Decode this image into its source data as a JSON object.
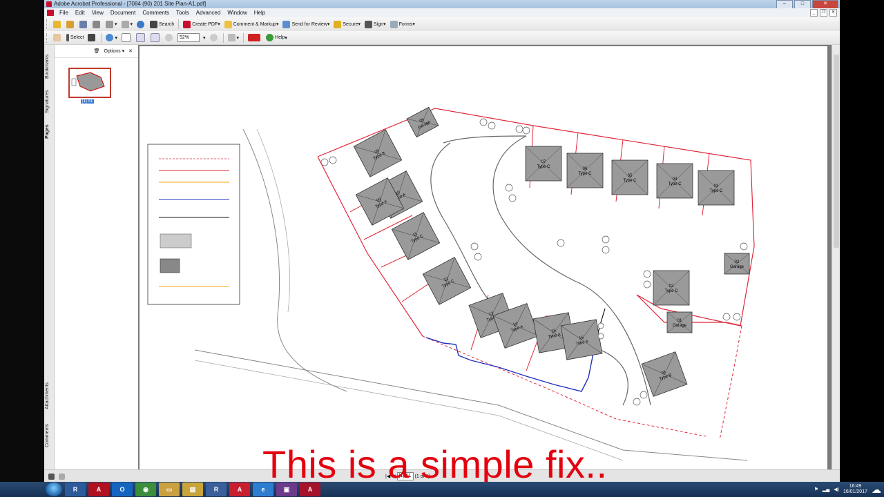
{
  "window": {
    "title": "Adobe Acrobat Professional - [7084 (90) 201  Site Plan-A1.pdf]"
  },
  "menu": [
    "File",
    "Edit",
    "View",
    "Document",
    "Comments",
    "Tools",
    "Advanced",
    "Window",
    "Help"
  ],
  "toolbar1": {
    "search": "Search",
    "create_pdf": "Create PDF",
    "comment_markup": "Comment & Markup",
    "send_review": "Send for Review",
    "secure": "Secure",
    "sign": "Sign",
    "forms": "Forms"
  },
  "toolbar2": {
    "select": "Select",
    "zoom": "52%",
    "help": "Help"
  },
  "nav_tabs": {
    "bookmarks": "Bookmarks",
    "signatures": "Signatures",
    "pages": "Pages",
    "attachments": "Attachments",
    "comments": "Comments"
  },
  "pages_pane": {
    "options": "Options",
    "thumb_label": "[1] A1"
  },
  "statusbar": {
    "page_box": "[1] A1",
    "page_of": "(1 of 1)"
  },
  "plan": {
    "houses": [
      {
        "num": "09",
        "type": "Type B"
      },
      {
        "num": "09",
        "type": "Garage"
      },
      {
        "num": "10",
        "type": "Type A"
      },
      {
        "num": "09",
        "type": "Type A"
      },
      {
        "num": "11",
        "type": "Type C"
      },
      {
        "num": "12",
        "type": "Type C"
      },
      {
        "num": "13",
        "type": "Type A"
      },
      {
        "num": "14",
        "type": "Type A"
      },
      {
        "num": "15",
        "type": "Type A"
      },
      {
        "num": "16",
        "type": "Type A"
      },
      {
        "num": "07",
        "type": "Type C"
      },
      {
        "num": "06",
        "type": "Type C"
      },
      {
        "num": "05",
        "type": "Type C"
      },
      {
        "num": "04",
        "type": "Type C"
      },
      {
        "num": "03",
        "type": "Type C"
      },
      {
        "num": "02",
        "type": "Type C"
      },
      {
        "num": "02",
        "type": "Garage"
      },
      {
        "num": "01",
        "type": "Garage"
      },
      {
        "num": "01",
        "type": "Type B"
      }
    ]
  },
  "caption": "This is a simple fix..",
  "taskbar": {
    "time": "16:49",
    "date": "16/01/2017"
  },
  "colors": {
    "boundary": "#e0263a",
    "fence_blue": "#1f2fbf",
    "orange": "#f2a400",
    "caption": "#e3000f"
  }
}
